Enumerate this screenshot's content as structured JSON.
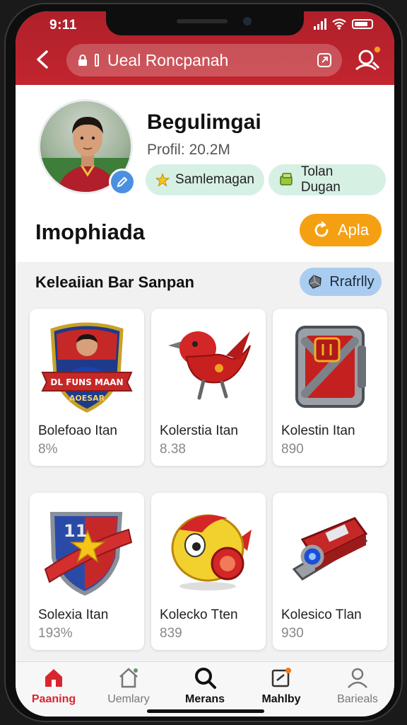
{
  "status": {
    "time": "9:11"
  },
  "header": {
    "url_text": "Ueal Roncpanah"
  },
  "profile": {
    "name": "Begulimgai",
    "stat": "Profil: 20.2M",
    "chips": [
      {
        "label": "Samlemagan",
        "icon": "star-icon"
      },
      {
        "label": "Tolan Dugan",
        "icon": "ticket-icon"
      }
    ],
    "section_title": "Imophiada",
    "apply_label": "Apla"
  },
  "collection": {
    "title": "Keleaiian Bar Sanpan",
    "filter_label": "Rrafrlly",
    "items": [
      {
        "name": "Bolefoao Itan",
        "value": "8%",
        "art": "team-badge-icon",
        "banner": "DL FUNS MAAN",
        "banner_sub": "AOESAR"
      },
      {
        "name": "Kolerstia Itan",
        "value": "8.38",
        "art": "red-bird-icon"
      },
      {
        "name": "Kolestin Itan",
        "value": "890",
        "art": "armored-chest-icon"
      },
      {
        "name": "Solexia Itan",
        "value": "193%",
        "art": "shield-star-icon"
      },
      {
        "name": "Kolecko Tten",
        "value": "839",
        "art": "yellow-pod-icon"
      },
      {
        "name": "Kolesico Tlan",
        "value": "930",
        "art": "red-device-icon"
      }
    ]
  },
  "nav": {
    "items": [
      {
        "label": "Paaning",
        "icon": "home-icon"
      },
      {
        "label": "Uemlary",
        "icon": "house-outline-icon"
      },
      {
        "label": "Merans",
        "icon": "search-icon"
      },
      {
        "label": "Mahlby",
        "icon": "note-icon"
      },
      {
        "label": "Barieals",
        "icon": "profile-icon"
      }
    ]
  },
  "colors": {
    "brand_red": "#c2252e",
    "accent_orange": "#f5a013",
    "chip_green": "#d6f0e4",
    "filter_blue": "#a9cdf0"
  }
}
